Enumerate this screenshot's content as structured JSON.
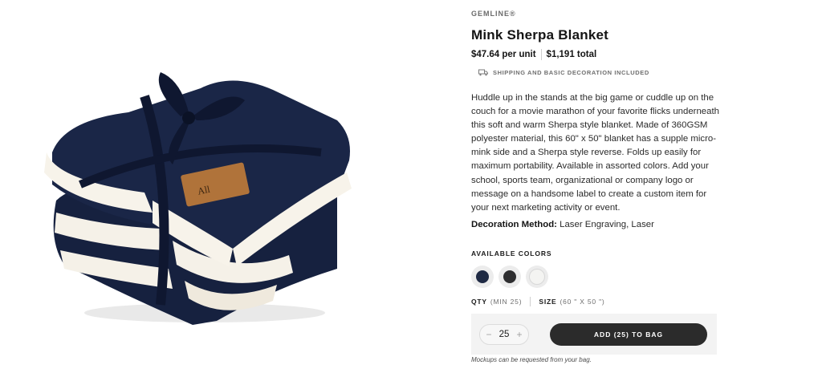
{
  "product": {
    "brand": "GEMLINE®",
    "title": "Mink Sherpa Blanket",
    "price_per_unit": "$47.64 per unit",
    "price_total": "$1,191 total",
    "shipping_note": "SHIPPING AND BASIC DECORATION INCLUDED",
    "description": "Huddle up in the stands at the big game or cuddle up on the couch for a movie marathon of your favorite flicks underneath this soft and warm Sherpa style blanket. Made of 360GSM polyester material, this 60\" x 50\" blanket has a supple micro-mink side and a Sherpa style reverse. Folds up easily for maximum portability. Available in assorted colors. Add your school, sports team, organizational or company logo or message on a handsome label to create a custom item for your next marketing activity or event.",
    "decoration_label": "Decoration Method:",
    "decoration_value": "Laser Engraving, Laser",
    "label_text": "All"
  },
  "colors": {
    "label": "AVAILABLE COLORS",
    "swatches": [
      {
        "name": "navy",
        "hex": "#1f2a44"
      },
      {
        "name": "charcoal",
        "hex": "#2e2e30"
      },
      {
        "name": "cream",
        "hex": "#f4f4f2"
      }
    ]
  },
  "options": {
    "qty_label": "QTY",
    "qty_min": "(MIN 25)",
    "size_label": "SIZE",
    "size_value": "(60 \" X 50 \")"
  },
  "cart": {
    "decrement": "−",
    "increment": "+",
    "quantity": "25",
    "add_button": "ADD (25) TO BAG",
    "note": "Mockups can be requested from your bag."
  },
  "theme": {
    "blanket_navy": "#16213f",
    "sherpa_cream": "#f5f1e8",
    "label_brown": "#b0733a",
    "button_dark": "#2b2b2b"
  }
}
